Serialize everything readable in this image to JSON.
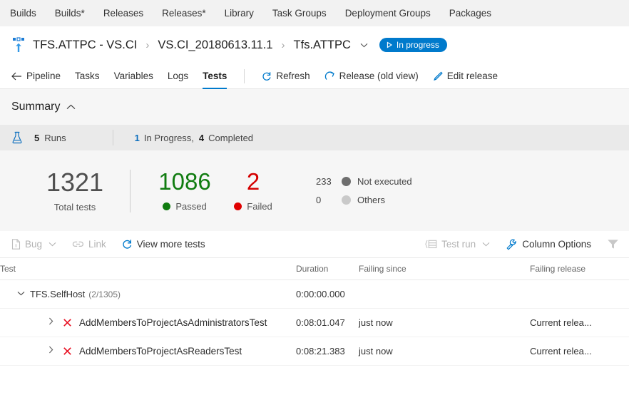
{
  "hub_nav": {
    "items": [
      {
        "label": "Builds",
        "name": "hub-builds"
      },
      {
        "label": "Builds*",
        "name": "hub-builds-star"
      },
      {
        "label": "Releases",
        "name": "hub-releases"
      },
      {
        "label": "Releases*",
        "name": "hub-releases-star"
      },
      {
        "label": "Library",
        "name": "hub-library"
      },
      {
        "label": "Task Groups",
        "name": "hub-task-groups"
      },
      {
        "label": "Deployment Groups",
        "name": "hub-deployment-groups"
      },
      {
        "label": "Packages",
        "name": "hub-packages"
      }
    ]
  },
  "breadcrumb": {
    "definition": "TFS.ATTPC - VS.CI",
    "separator": "›",
    "release": "VS.CI_20180613.11.1",
    "environment": "Tfs.ATTPC",
    "environment_chevron": "⌵",
    "status_badge": {
      "label": "In progress",
      "icon": "play-triangle-icon",
      "color": "#007acc"
    }
  },
  "pivots": {
    "back_label": "Pipeline",
    "items": [
      {
        "label": "Tasks",
        "active": false
      },
      {
        "label": "Variables",
        "active": false
      },
      {
        "label": "Logs",
        "active": false
      },
      {
        "label": "Tests",
        "active": true
      }
    ],
    "commands": [
      {
        "label": "Refresh",
        "icon": "refresh-icon"
      },
      {
        "label": "Release (old view)",
        "icon": "open-arrow-icon"
      },
      {
        "label": "Edit release",
        "icon": "pencil-icon"
      }
    ]
  },
  "summary": {
    "title": "Summary",
    "collapse_caret": "⌃",
    "runs": {
      "count": "5",
      "label": "Runs",
      "in_progress_count": "1",
      "in_progress_label": "In Progress,",
      "completed_count": "4",
      "completed_label": "Completed"
    },
    "total": {
      "value": "1321",
      "label": "Total tests"
    },
    "passed": {
      "value": "1086",
      "label": "Passed",
      "color": "#107c10"
    },
    "failed": {
      "value": "2",
      "label": "Failed",
      "color": "#d40000"
    },
    "not_executed": {
      "value": "233",
      "label": "Not executed",
      "color": "#6e6e6e"
    },
    "others": {
      "value": "0",
      "label": "Others",
      "color": "#c9c9c9"
    }
  },
  "grid_toolbar": {
    "bug": {
      "label": "Bug",
      "icon": "file-bug-icon",
      "disabled": true,
      "chevron": "⌵"
    },
    "link": {
      "label": "Link",
      "icon": "link-icon",
      "disabled": true
    },
    "view_more": {
      "label": "View more tests",
      "icon": "refresh-icon",
      "disabled": false
    },
    "test_run": {
      "label": "Test run",
      "icon": "panel-icon",
      "disabled": true,
      "chevron": "⌵"
    },
    "column_options": {
      "label": "Column Options",
      "icon": "wrench-icon",
      "disabled": false
    },
    "filter": {
      "icon": "funnel-icon",
      "label": ""
    }
  },
  "table": {
    "columns": [
      "Test",
      "Duration",
      "Failing since",
      "Failing release"
    ],
    "group": {
      "caret": "⌵",
      "name": "TFS.SelfHost",
      "count": "(2/1305)",
      "duration": "0:00:00.000",
      "failing_since": "",
      "failing_release": ""
    },
    "rows": [
      {
        "caret": "›",
        "status_icon": "failed-x-icon",
        "name": "AddMembersToProjectAsAdministratorsTest",
        "duration": "0:08:01.047",
        "failing_since": "just now",
        "failing_release": "Current relea..."
      },
      {
        "caret": "›",
        "status_icon": "failed-x-icon",
        "name": "AddMembersToProjectAsReadersTest",
        "duration": "0:08:21.383",
        "failing_since": "just now",
        "failing_release": "Current relea..."
      }
    ]
  }
}
